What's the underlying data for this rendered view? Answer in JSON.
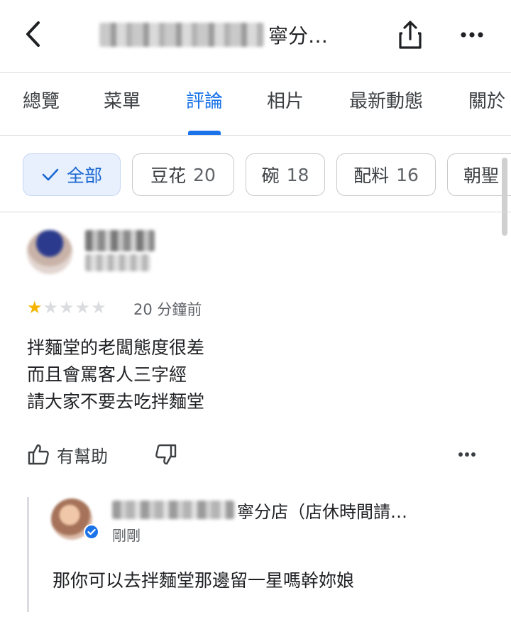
{
  "header": {
    "title_suffix": "寧分…",
    "back_icon": "chevron-left-icon",
    "share_icon": "share-icon",
    "more_icon": "more-horizontal-icon"
  },
  "tabs": [
    {
      "label": "總覽",
      "active": false
    },
    {
      "label": "菜單",
      "active": false
    },
    {
      "label": "評論",
      "active": true
    },
    {
      "label": "相片",
      "active": false
    },
    {
      "label": "最新動態",
      "active": false
    },
    {
      "label": "關於",
      "active": false
    }
  ],
  "chips": [
    {
      "label": "全部",
      "count": "",
      "selected": true
    },
    {
      "label": "豆花",
      "count": "20",
      "selected": false
    },
    {
      "label": "碗",
      "count": "18",
      "selected": false
    },
    {
      "label": "配料",
      "count": "16",
      "selected": false
    },
    {
      "label": "朝聖",
      "count": "",
      "selected": false
    }
  ],
  "review": {
    "rating": 1,
    "max_rating": 5,
    "time": "20 分鐘前",
    "lines": [
      "拌麵堂的老闆態度很差",
      "而且會罵客人三字經",
      "請大家不要去吃拌麵堂"
    ],
    "helpful_label": "有幫助"
  },
  "owner_reply": {
    "name_suffix": "寧分店（店休時間請…",
    "time": "剛剛",
    "text": "那你可以去拌麵堂那邊留一星嗎幹妳娘"
  },
  "colors": {
    "accent": "#1a73e8",
    "star": "#f4b400",
    "chip_selected_bg": "#e8f0fe"
  }
}
